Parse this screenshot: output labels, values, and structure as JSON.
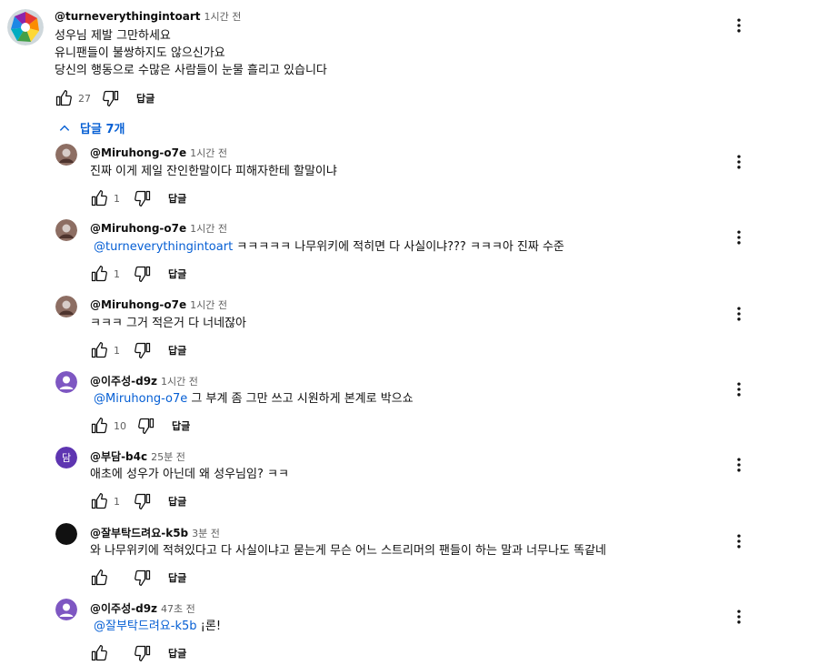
{
  "top": {
    "author": "@turneverythingintoart",
    "time": "1시간 전",
    "lines": [
      "성우님 제발 그만하세요",
      "유니팬들이 불쌍하지도 않으신가요",
      "당신의 행동으로 수많은 사람들이 눈물 흘리고 있습니다"
    ],
    "likes": "27",
    "reply_label": "답글"
  },
  "replies_toggle": "답글 7개",
  "replies": [
    {
      "author": "@Miruhong-o7e",
      "time": "1시간 전",
      "mention": "",
      "text": "진짜 이게 제일 잔인한말이다 피해자한테 할말이냐",
      "likes": "1",
      "reply_label": "답글"
    },
    {
      "author": "@Miruhong-o7e",
      "time": "1시간 전",
      "mention": "@turneverythingintoart",
      "text": " ㅋㅋㅋㅋㅋ 나무위키에 적히면 다 사실이냐??? ㅋㅋㅋ아 진짜 수준",
      "likes": "1",
      "reply_label": "답글"
    },
    {
      "author": "@Miruhong-o7e",
      "time": "1시간 전",
      "mention": "",
      "text": "ㅋㅋㅋ 그거 적은거 다 너네잖아",
      "likes": "1",
      "reply_label": "답글"
    },
    {
      "author": "@이주성-d9z",
      "time": "1시간 전",
      "mention": "@Miruhong-o7e",
      "text": " 그 부계 좀 그만 쓰고 시원하게 본계로 박으쇼",
      "likes": "10",
      "reply_label": "답글"
    },
    {
      "author": "@부담-b4c",
      "time": "25분 전",
      "mention": "",
      "text": "애초에 성우가 아닌데 왜 성우님임? ㅋㅋ",
      "likes": "1",
      "reply_label": "답글",
      "avatar_letter": "담"
    },
    {
      "author": "@잘부탁드려요-k5b",
      "time": "3분 전",
      "mention": "",
      "text": "와 나무위키에 적혀있다고 다 사실이냐고 묻는게 무슨 어느 스트리머의 팬들이 하는 말과 너무나도 똑같네",
      "likes": "",
      "reply_label": "답글"
    },
    {
      "author": "@이주성-d9z",
      "time": "47초 전",
      "mention": "@잘부탁드려요-k5b",
      "text": " ¡론!",
      "likes": "",
      "reply_label": "답글"
    }
  ],
  "colors": {
    "link": "#065fd4",
    "purple_avatar": "#7e57c2",
    "dark_purple_avatar": "#5e35b1",
    "brown_avatar": "#6d4c41"
  },
  "icons": [
    "thumb-up-icon",
    "thumb-down-icon",
    "more-vert-icon",
    "chevron-up-icon"
  ]
}
